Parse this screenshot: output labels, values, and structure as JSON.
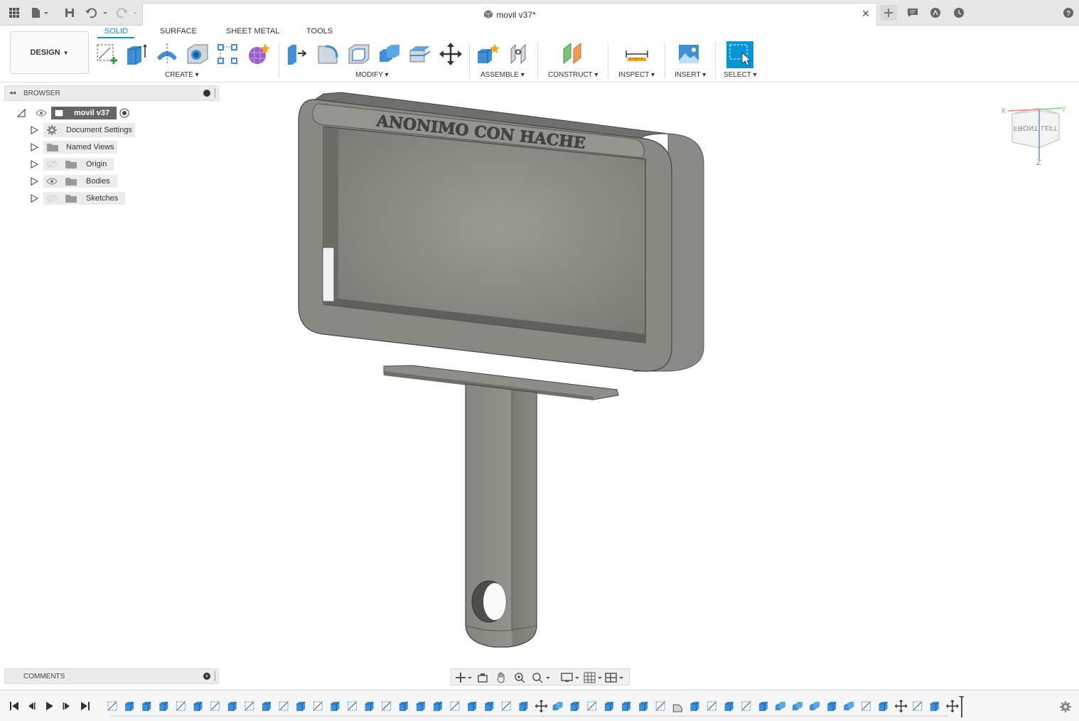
{
  "window": {
    "document_title": "movil v37*"
  },
  "toolbar": {
    "design_label": "DESIGN",
    "tabs": [
      {
        "label": "SOLID",
        "active": true
      },
      {
        "label": "SURFACE",
        "active": false
      },
      {
        "label": "SHEET METAL",
        "active": false
      },
      {
        "label": "TOOLS",
        "active": false
      }
    ],
    "groups": {
      "create": "CREATE",
      "modify": "MODIFY",
      "assemble": "ASSEMBLE",
      "construct": "CONSTRUCT",
      "inspect": "INSPECT",
      "insert": "INSERT",
      "select": "SELECT"
    }
  },
  "browser": {
    "title": "BROWSER",
    "root": "movil v37",
    "items": [
      {
        "label": "Document Settings",
        "icon": "gear-icon"
      },
      {
        "label": "Named Views",
        "icon": "folder-icon"
      },
      {
        "label": "Origin",
        "icon": "folder-icon",
        "visible": false
      },
      {
        "label": "Bodies",
        "icon": "folder-icon",
        "visible": true
      },
      {
        "label": "Sketches",
        "icon": "folder-icon",
        "visible": false
      }
    ]
  },
  "viewport": {
    "model_text": "ANONIMO CON HACHE",
    "viewcube": {
      "front": "FRONT",
      "left": "LEFT",
      "x": "X",
      "y": "Y",
      "z": "Z"
    }
  },
  "comments": {
    "title": "COMMENTS"
  },
  "timeline": {
    "highlighted_indices": [
      21,
      22
    ]
  },
  "colors": {
    "accent": "#0696d7",
    "model": "#8c8c88",
    "highlight": "#f5f52a"
  }
}
